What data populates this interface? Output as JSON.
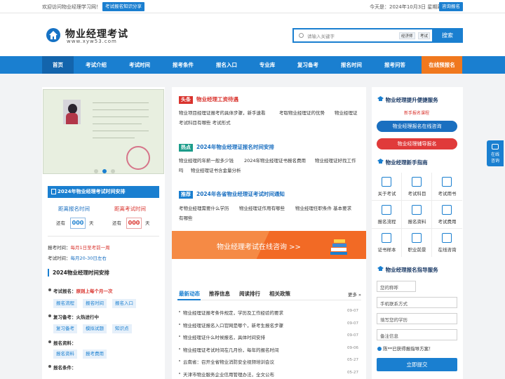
{
  "topbar": {
    "welcome": "欢迎访问物业经理学习网！",
    "share_label": "考试报名知识分享",
    "date": "今天是：2024年10月3日 星期四",
    "consult_label": "咨询报名"
  },
  "header": {
    "logo_title": "物业经理考试",
    "logo_url": "www.xyw53.com",
    "search_placeholder": "请输入关键字",
    "search_tags": [
      "经济师",
      "考试"
    ],
    "search_button": "搜索"
  },
  "nav": {
    "items": [
      "首页",
      "考试介绍",
      "考试时间",
      "报考条件",
      "报名入口",
      "专业库",
      "复习备考",
      "报名时间",
      "报考问答"
    ],
    "book_label": "在线预报名"
  },
  "left": {
    "box_title": "2024年物业经理考试时间安排",
    "countdown": [
      {
        "label": "距离报名时间",
        "prefix": "还有",
        "days": "000",
        "unit": "天"
      },
      {
        "label": "距离考试时间",
        "prefix": "还有",
        "days": "000",
        "unit": "天"
      }
    ],
    "reg_label": "报考时间：",
    "reg_value": "每月1日至考前一周",
    "exam_label": "考试时间：",
    "exam_value": "每月20-30日左右",
    "schedule_title": "2024物业经理时间安排",
    "groups": [
      {
        "label": "考试报名：",
        "highlight": "原则上每个月一次",
        "tags": [
          "报名流程",
          "报名时间",
          "报名入口"
        ]
      },
      {
        "label": "复习备考：",
        "highlight": "火热进行中",
        "tags": [
          "复习备考",
          "模拟试题",
          "知识点"
        ]
      },
      {
        "label": "报名资料：",
        "highlight": "",
        "tags": [
          "报名资料",
          "报考费用"
        ]
      },
      {
        "label": "报名条件：",
        "highlight": "",
        "tags": []
      }
    ]
  },
  "middle": {
    "headlines": [
      {
        "badge": "头条",
        "badge_color": "#d9332d",
        "title": "物业经理工资待遇",
        "title_color": "#d9332d",
        "lines": [
          "物业项目经理证报考的具体步骤，新手速看",
          "考取物业经理证的优势",
          "物业经理证",
          "考试科目有哪些 考试形式"
        ]
      },
      {
        "badge": "热点",
        "badge_color": "#1b9c8a",
        "title": "2024年物业经理证报名时间安排",
        "title_color": "#1a6fc0",
        "lines": [
          "物业经理的年薪一般多少钱",
          "2024年物业经理证书报名费用",
          "物业经理证好找工作",
          "吗",
          "物业经理证书含金量分析"
        ]
      },
      {
        "badge": "推荐",
        "badge_color": "#1a7fd0",
        "title": "2024年各省物业经理证考试时间通知",
        "title_color": "#1a6fc0",
        "lines": [
          "考物业经理需要什么学历",
          "物业经理证作用有哪些",
          "物业经理任职条件 基本要求",
          "有哪些"
        ]
      }
    ],
    "banner_text": "物业经理考试在线咨询 >>",
    "tabs": [
      "最新动态",
      "推荐信息",
      "阅读排行",
      "相关政策"
    ],
    "more": "更多 »",
    "news": [
      {
        "text": "物业经理证报考条件规定，学历及工作经验的要求",
        "date": "09-07"
      },
      {
        "text": "物业经理证报名入口官网是哪个，新考生报名步骤",
        "date": "09-07"
      },
      {
        "text": "物业经理证什么时候报名，具体时间安排",
        "date": "09-07"
      },
      {
        "text": "物业经理证考试时间在几月份，每年的报名时间",
        "date": "09-06"
      },
      {
        "text": "云南省：召开全省物业消防安全视频培训会议",
        "date": "05-27"
      },
      {
        "text": "天津市物业服务企业信用管理办法，全文公布",
        "date": "05-27"
      }
    ]
  },
  "right": {
    "service_title": "物业经理提升便捷服务",
    "service_sub": "新手报名课程",
    "btn_consult": "物业经理报名在线咨询",
    "btn_coach": "物业经理辅导报名",
    "guide_title": "物业经理新手指南",
    "guide_items": [
      "关于考试",
      "考试科目",
      "考试用书",
      "报名流程",
      "报名资料",
      "考试费用",
      "证书样本",
      "职业前景",
      "在线咨询"
    ],
    "form_title": "物业经理报名指导服务",
    "fields": [
      "您的称呼",
      "手机联系方式",
      "填写您的学历",
      "备注信息"
    ],
    "notice": "陈**已获得报指导方案！",
    "submit": "立即提交"
  },
  "float": {
    "line1": "在线",
    "line2": "咨询"
  }
}
